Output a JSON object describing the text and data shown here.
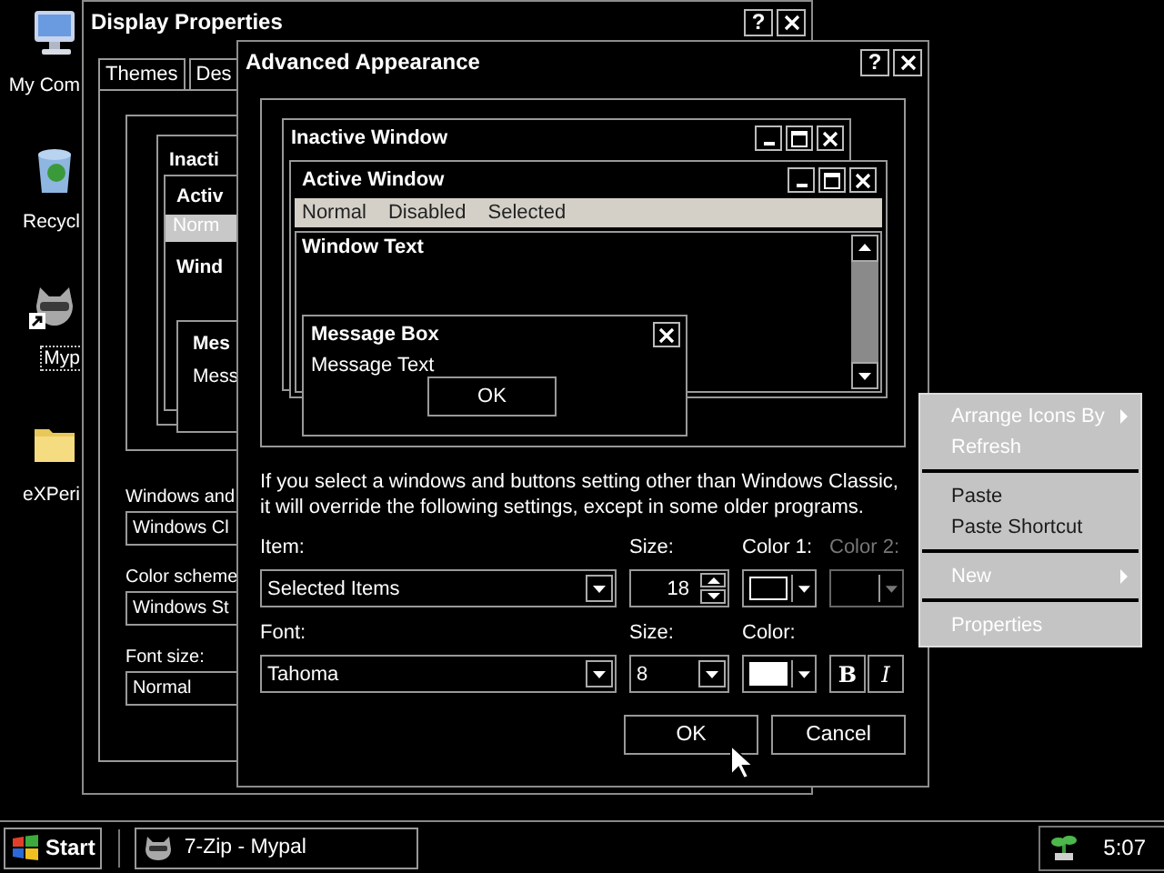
{
  "desktop_icons": [
    {
      "label": "My Com",
      "kind": "computer",
      "selected": false
    },
    {
      "label": "Recycl",
      "kind": "recycle-bin",
      "selected": false
    },
    {
      "label": "Myp",
      "kind": "shortcut",
      "selected": true
    },
    {
      "label": "eXPeri",
      "kind": "folder",
      "selected": false
    }
  ],
  "display_properties": {
    "title": "Display Properties",
    "help_button": "?",
    "tabs": [
      {
        "label": "Themes",
        "selected": false
      },
      {
        "label": "Des",
        "selected": false
      }
    ],
    "preview": {
      "inactive_title": "Inacti",
      "active_title": "Activ",
      "menu_item": "Norm",
      "window_text": "Wind",
      "message_title": "Mes",
      "message_text": "Mess"
    },
    "fields": [
      {
        "label": "Windows and",
        "value": "Windows Cl"
      },
      {
        "label": "Color scheme",
        "value": "Windows St"
      },
      {
        "label": "Font size:",
        "value": "Normal"
      }
    ]
  },
  "advanced_appearance": {
    "title": "Advanced Appearance",
    "help_button": "?",
    "preview": {
      "inactive_title": "Inactive Window",
      "active_title": "Active Window",
      "menu": [
        "Normal",
        "Disabled",
        "Selected"
      ],
      "window_text": "Window Text",
      "message_title": "Message Box",
      "message_text": "Message Text",
      "message_button": "OK"
    },
    "note": "If you select a windows and buttons setting other than Windows Classic, it will override the following settings, except in some older programs.",
    "item": {
      "label": "Item:",
      "value": "Selected Items"
    },
    "item_size": {
      "label": "Size:",
      "value": "18"
    },
    "color1": {
      "label": "Color 1:",
      "color": "#000000",
      "disabled": false
    },
    "color2": {
      "label": "Color 2:",
      "disabled": true
    },
    "font": {
      "label": "Font:",
      "value": "Tahoma"
    },
    "font_size": {
      "label": "Size:",
      "value": "8"
    },
    "font_color": {
      "label": "Color:",
      "color": "#ffffff",
      "disabled": false
    },
    "style_buttons": [
      {
        "label": "B",
        "kind": "bold"
      },
      {
        "label": "I",
        "kind": "italic"
      }
    ],
    "buttons": [
      "OK",
      "Cancel"
    ]
  },
  "context_menu": [
    {
      "kind": "item",
      "label": "Arrange Icons By",
      "submenu": true,
      "disabled": false
    },
    {
      "kind": "item",
      "label": "Refresh",
      "submenu": false,
      "disabled": false
    },
    {
      "kind": "separator"
    },
    {
      "kind": "item",
      "label": "Paste",
      "submenu": false,
      "disabled": true
    },
    {
      "kind": "item",
      "label": "Paste Shortcut",
      "submenu": false,
      "disabled": true
    },
    {
      "kind": "separator"
    },
    {
      "kind": "item",
      "label": "New",
      "submenu": true,
      "disabled": false
    },
    {
      "kind": "separator"
    },
    {
      "kind": "item",
      "label": "Properties",
      "submenu": false,
      "disabled": false
    }
  ],
  "taskbar": {
    "start": "Start",
    "tasks": [
      {
        "label": "7-Zip - Mypal",
        "selected": false
      }
    ],
    "clock": "5:07"
  }
}
